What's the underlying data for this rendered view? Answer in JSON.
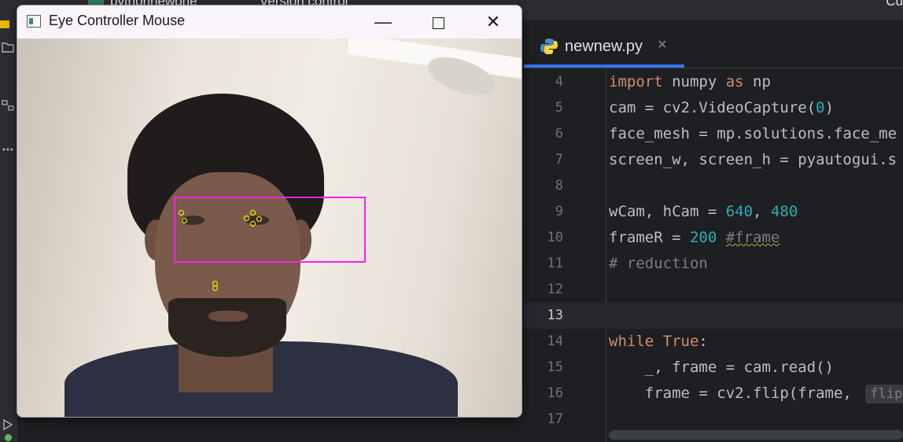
{
  "ide": {
    "top_project": "pythonnewone",
    "top_vc": "Version control",
    "top_trunc": "Cu",
    "tab": {
      "filename": "newnew.py",
      "close": "×"
    },
    "lines": [
      {
        "n": "4",
        "parts": [
          [
            "kw",
            "import"
          ],
          [
            "",
            " numpy "
          ],
          [
            "kw",
            "as"
          ],
          [
            "",
            " np"
          ]
        ]
      },
      {
        "n": "5",
        "parts": [
          [
            "",
            "cam = cv2.VideoCapture("
          ],
          [
            "num",
            "0"
          ],
          [
            "",
            ")"
          ]
        ]
      },
      {
        "n": "6",
        "parts": [
          [
            "",
            "face_mesh = mp.solutions.face_me"
          ]
        ]
      },
      {
        "n": "7",
        "parts": [
          [
            "",
            "screen_w, screen_h = pyautogui.s"
          ]
        ]
      },
      {
        "n": "8",
        "parts": []
      },
      {
        "n": "9",
        "parts": [
          [
            "",
            "wCam, hCam = "
          ],
          [
            "num",
            "640"
          ],
          [
            "",
            ", "
          ],
          [
            "num",
            "480"
          ]
        ]
      },
      {
        "n": "10",
        "parts": [
          [
            "",
            "frameR = "
          ],
          [
            "num",
            "200"
          ],
          [
            "",
            " "
          ],
          [
            "cmw",
            "#frame"
          ]
        ]
      },
      {
        "n": "11",
        "parts": [
          [
            "cm",
            "# reduction"
          ]
        ]
      },
      {
        "n": "12",
        "parts": []
      },
      {
        "n": "13",
        "parts": [],
        "current": true
      },
      {
        "n": "14",
        "parts": [
          [
            "kw",
            "while"
          ],
          [
            "",
            " "
          ],
          [
            "kw",
            "True"
          ],
          [
            "",
            ":"
          ]
        ]
      },
      {
        "n": "15",
        "parts": [
          [
            "",
            "    _, frame = cam.read()"
          ]
        ]
      },
      {
        "n": "16",
        "parts": [
          [
            "",
            "    frame = cv2.flip(frame, "
          ]
        ],
        "hint": "flip"
      },
      {
        "n": "17",
        "parts": []
      }
    ]
  },
  "window": {
    "title": "Eye Controller Mouse",
    "min_glyph": "—",
    "close_glyph": "✕"
  },
  "icons": {
    "app": "window-app-icon",
    "python": "python-file-icon",
    "folder": "folder-icon",
    "structure": "structure-icon",
    "more": "more-icon",
    "run": "run-icon"
  }
}
